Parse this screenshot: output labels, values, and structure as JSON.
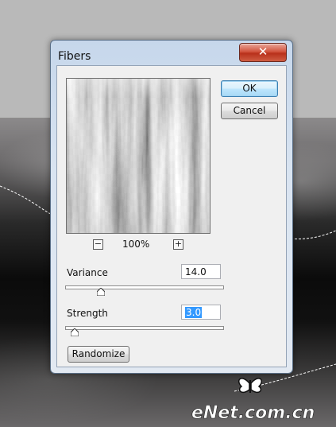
{
  "dialog": {
    "title": "Fibers",
    "close_glyph": "✕",
    "ok_label": "OK",
    "cancel_label": "Cancel",
    "zoom": {
      "minus_glyph": "−",
      "plus_glyph": "+",
      "level": "100%"
    },
    "variance": {
      "label": "Variance",
      "value": "14.0",
      "slider_fraction": 0.21
    },
    "strength": {
      "label": "Strength",
      "value": "3.0",
      "slider_fraction": 0.03
    },
    "randomize_label": "Randomize"
  },
  "watermark": {
    "text": "eNet.com.cn",
    "icon": "butterfly-logo-icon"
  },
  "colors": {
    "title_bar": "#c6d7eb",
    "close_button": "#c8402b",
    "selection": "#3399ff",
    "ok_focus": "#3c7fb1"
  }
}
